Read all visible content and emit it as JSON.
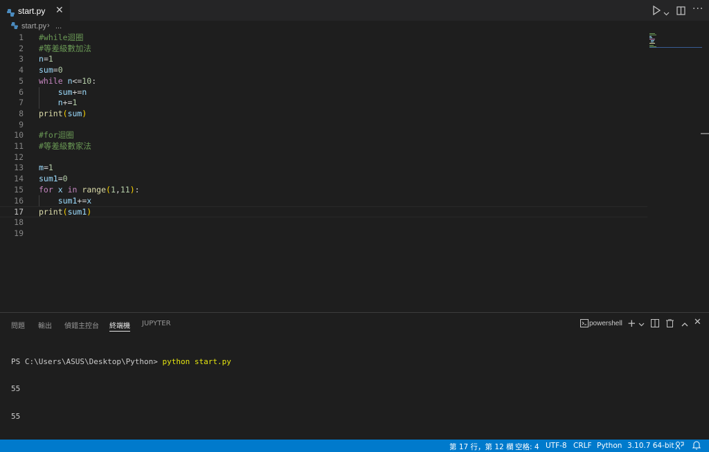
{
  "tab": {
    "filename": "start.py",
    "close": "✕"
  },
  "breadcrumb": {
    "file": "start.py",
    "separator": "›",
    "more": "..."
  },
  "editor": {
    "lines": [
      {
        "n": "1",
        "tokens": [
          [
            "c-com",
            "#while迴圈"
          ]
        ]
      },
      {
        "n": "2",
        "tokens": [
          [
            "c-com",
            "#等差級數加法"
          ]
        ]
      },
      {
        "n": "3",
        "tokens": [
          [
            "c-var",
            "n"
          ],
          [
            "c-op",
            "="
          ],
          [
            "c-num",
            "1"
          ]
        ]
      },
      {
        "n": "4",
        "tokens": [
          [
            "c-var",
            "sum"
          ],
          [
            "c-op",
            "="
          ],
          [
            "c-num",
            "0"
          ]
        ]
      },
      {
        "n": "5",
        "tokens": [
          [
            "c-kw",
            "while"
          ],
          [
            "c-op",
            " "
          ],
          [
            "c-var",
            "n"
          ],
          [
            "c-op",
            "<="
          ],
          [
            "c-num",
            "10"
          ],
          [
            "c-op",
            ":"
          ]
        ]
      },
      {
        "n": "6",
        "tokens": [
          [
            "c-op",
            "    "
          ],
          [
            "c-var",
            "sum"
          ],
          [
            "c-op",
            "+="
          ],
          [
            "c-var",
            "n"
          ]
        ]
      },
      {
        "n": "7",
        "tokens": [
          [
            "c-op",
            "    "
          ],
          [
            "c-var",
            "n"
          ],
          [
            "c-op",
            "+="
          ],
          [
            "c-num",
            "1"
          ]
        ]
      },
      {
        "n": "8",
        "tokens": [
          [
            "c-fn",
            "print"
          ],
          [
            "c-paren",
            "("
          ],
          [
            "c-var",
            "sum"
          ],
          [
            "c-paren",
            ")"
          ]
        ]
      },
      {
        "n": "9",
        "tokens": []
      },
      {
        "n": "10",
        "tokens": [
          [
            "c-com",
            "#for迴圈"
          ]
        ]
      },
      {
        "n": "11",
        "tokens": [
          [
            "c-com",
            "#等差級數家法"
          ]
        ]
      },
      {
        "n": "12",
        "tokens": []
      },
      {
        "n": "13",
        "tokens": [
          [
            "c-var",
            "m"
          ],
          [
            "c-op",
            "="
          ],
          [
            "c-num",
            "1"
          ]
        ]
      },
      {
        "n": "14",
        "tokens": [
          [
            "c-var",
            "sum1"
          ],
          [
            "c-op",
            "="
          ],
          [
            "c-num",
            "0"
          ]
        ]
      },
      {
        "n": "15",
        "tokens": [
          [
            "c-kw",
            "for"
          ],
          [
            "c-op",
            " "
          ],
          [
            "c-var",
            "x"
          ],
          [
            "c-op",
            " "
          ],
          [
            "c-kw",
            "in"
          ],
          [
            "c-op",
            " "
          ],
          [
            "c-fn",
            "range"
          ],
          [
            "c-paren",
            "("
          ],
          [
            "c-num",
            "1"
          ],
          [
            "c-op",
            ","
          ],
          [
            "c-num",
            "11"
          ],
          [
            "c-paren",
            ")"
          ],
          [
            "c-op",
            ":"
          ]
        ]
      },
      {
        "n": "16",
        "tokens": [
          [
            "c-op",
            "    "
          ],
          [
            "c-var",
            "sum1"
          ],
          [
            "c-op",
            "+="
          ],
          [
            "c-var",
            "x"
          ]
        ]
      },
      {
        "n": "17",
        "tokens": [
          [
            "c-fn",
            "print"
          ],
          [
            "c-paren",
            "("
          ],
          [
            "c-var",
            "sum1"
          ],
          [
            "c-paren",
            ")"
          ]
        ]
      },
      {
        "n": "18",
        "tokens": []
      },
      {
        "n": "19",
        "tokens": []
      }
    ],
    "active_line": "17"
  },
  "panel": {
    "tabs": [
      "問題",
      "輸出",
      "偵錯主控台",
      "終端機",
      "JUPYTER"
    ],
    "active_tab": "終端機",
    "shell": "powershell",
    "terminal": {
      "prompt": "PS C:\\Users\\ASUS\\Desktop\\Python> ",
      "command": "python start.py",
      "outputs": [
        "55",
        "55"
      ]
    }
  },
  "status": {
    "position": "第 17 行，第 12 欄",
    "spaces": "空格: 4",
    "encoding": "UTF-8",
    "eol": "CRLF",
    "language": "Python",
    "interpreter": "3.10.7 64-bit"
  },
  "colors": {
    "status_bar": "#007acc",
    "editor_bg": "#1e1e1e",
    "tabbar_bg": "#252526"
  }
}
